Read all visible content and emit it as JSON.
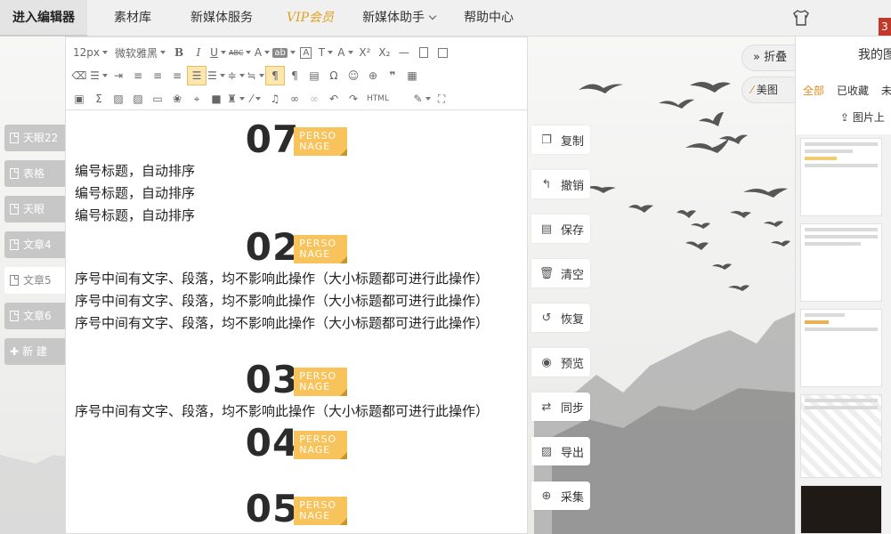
{
  "nav": {
    "items": [
      {
        "label": "进入编辑器",
        "active": true
      },
      {
        "label": "素材库"
      },
      {
        "label": "新媒体服务"
      },
      {
        "label": "VIP会员",
        "vip": true
      },
      {
        "label": "新媒体助手",
        "dropdown": true
      },
      {
        "label": "帮助中心"
      }
    ],
    "badge": "3"
  },
  "docs": [
    {
      "label": "天眼22"
    },
    {
      "label": "表格"
    },
    {
      "label": "天眼"
    },
    {
      "label": "文章4"
    },
    {
      "label": "文章5",
      "active": true
    },
    {
      "label": "文章6"
    }
  ],
  "new_doc_label": "新 建",
  "toolbar": {
    "font_size": "12px",
    "font_family": "微软雅黑",
    "html_label": "HTML"
  },
  "content": {
    "persona_top": "PERSO",
    "persona_bottom": "NAGE",
    "blocks": [
      {
        "num": "07",
        "lines": [
          "编号标题，自动排序",
          "编号标题，自动排序",
          "编号标题，自动排序"
        ]
      },
      {
        "num": "02",
        "lines": [
          "序号中间有文字、段落，均不影响此操作（大小标题都可进行此操作）",
          "序号中间有文字、段落，均不影响此操作（大小标题都可进行此操作）",
          "序号中间有文字、段落，均不影响此操作（大小标题都可进行此操作）"
        ]
      },
      {
        "num": "03",
        "lines": [
          "序号中间有文字、段落，均不影响此操作（大小标题都可进行此操作）"
        ]
      },
      {
        "num": "04",
        "lines": []
      },
      {
        "num": "05",
        "lines": []
      }
    ]
  },
  "actions": [
    {
      "label": "复制",
      "icon": "copy-icon"
    },
    {
      "label": "撤销",
      "icon": "undo-icon"
    },
    {
      "label": "保存",
      "icon": "save-icon"
    },
    {
      "label": "清空",
      "icon": "trash-icon"
    },
    {
      "label": "恢复",
      "icon": "restore-icon"
    },
    {
      "label": "预览",
      "icon": "eye-icon"
    },
    {
      "label": "同步",
      "icon": "sync-icon"
    },
    {
      "label": "导出",
      "icon": "export-icon"
    },
    {
      "label": "采集",
      "icon": "collect-icon"
    }
  ],
  "fold_label": "折叠",
  "meitu_label": "美图",
  "right_panel": {
    "title": "我的图",
    "tabs": [
      "全部",
      "已收藏",
      "未"
    ],
    "upload_label": "图片上"
  },
  "colors": {
    "accent": "#e28a1b",
    "persona_bg": "#f7c35a",
    "vip": "#e0a020"
  }
}
